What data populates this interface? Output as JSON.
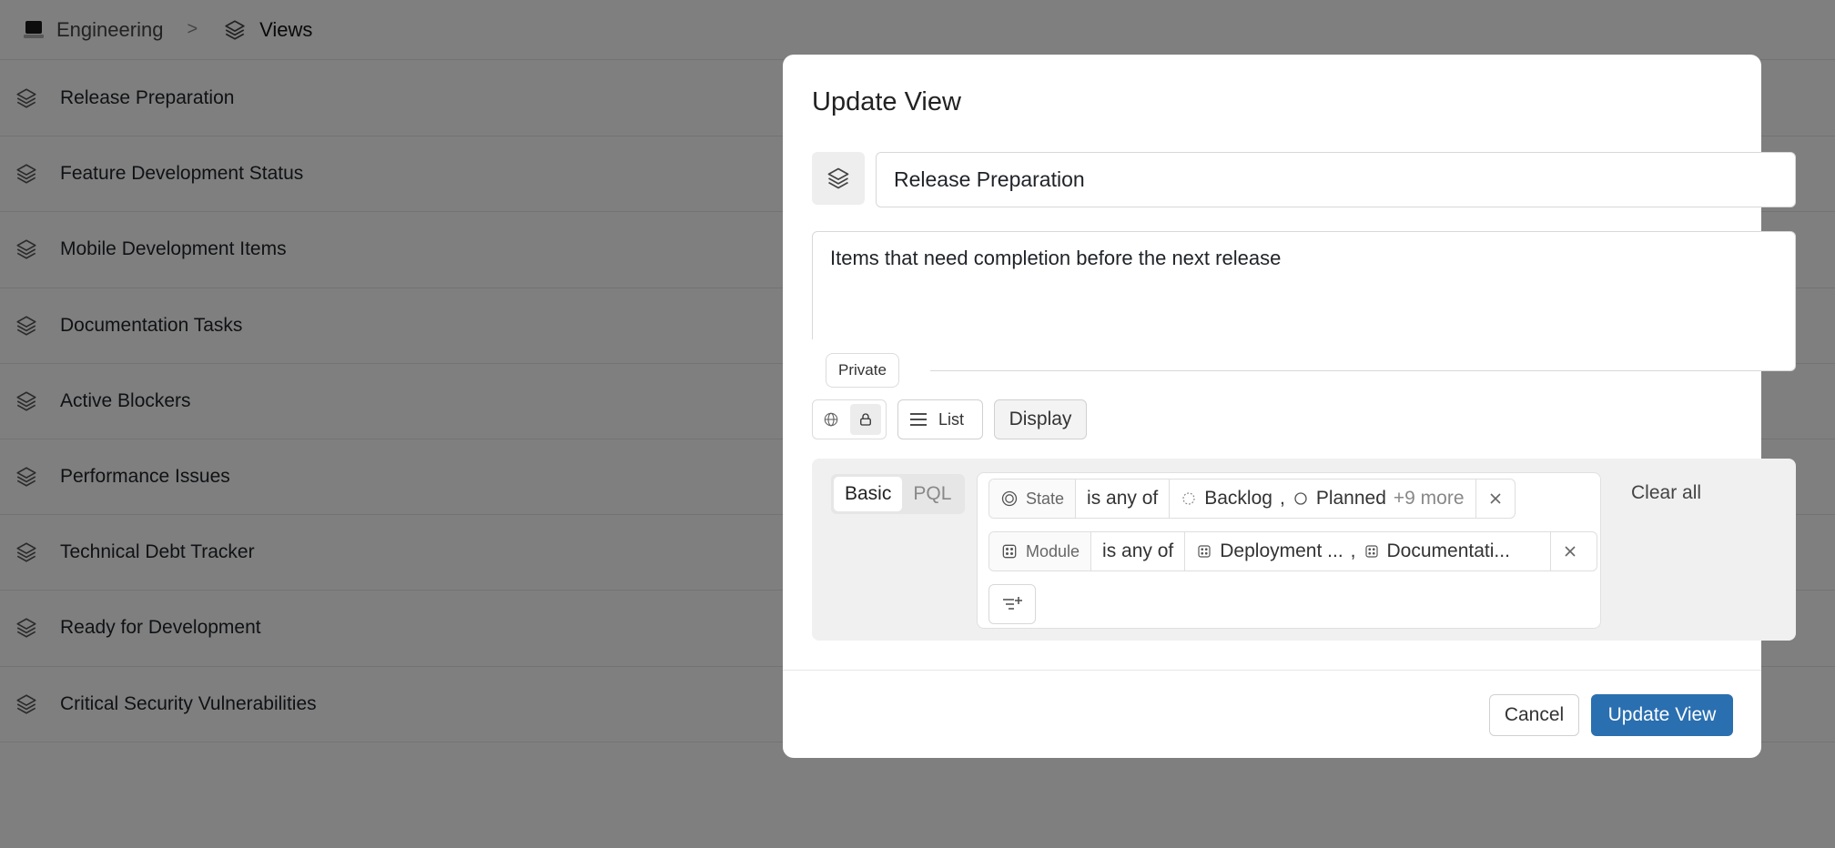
{
  "breadcrumb": {
    "workspace": "Engineering",
    "separator": ">",
    "current": "Views"
  },
  "views": [
    {
      "label": "Release Preparation"
    },
    {
      "label": "Feature Development Status"
    },
    {
      "label": "Mobile Development Items"
    },
    {
      "label": "Documentation Tasks"
    },
    {
      "label": "Active Blockers"
    },
    {
      "label": "Performance Issues"
    },
    {
      "label": "Technical Debt Tracker"
    },
    {
      "label": "Ready for Development"
    },
    {
      "label": "Critical Security Vulnerabilities"
    }
  ],
  "modal": {
    "title": "Update View",
    "name_value": "Release Preparation",
    "description_value": "Items that need completion before the next release",
    "access": {
      "tooltip": "Private",
      "selected": "private"
    },
    "layout_label": "List",
    "display_label": "Display",
    "filters": {
      "tabs": [
        "Basic",
        "PQL"
      ],
      "active_tab": "Basic",
      "rows": [
        {
          "property": "State",
          "operator": "is any of",
          "values": [
            "Backlog",
            "Planned"
          ],
          "more": "+9 more"
        },
        {
          "property": "Module",
          "operator": "is any of",
          "values": [
            "Deployment ...",
            "Documentati..."
          ]
        }
      ],
      "clear_all": "Clear all"
    },
    "cancel_label": "Cancel",
    "submit_label": "Update View"
  },
  "colors": {
    "primary": "#2a6fb0",
    "overlay": "rgba(0,0,0,0.5)"
  }
}
